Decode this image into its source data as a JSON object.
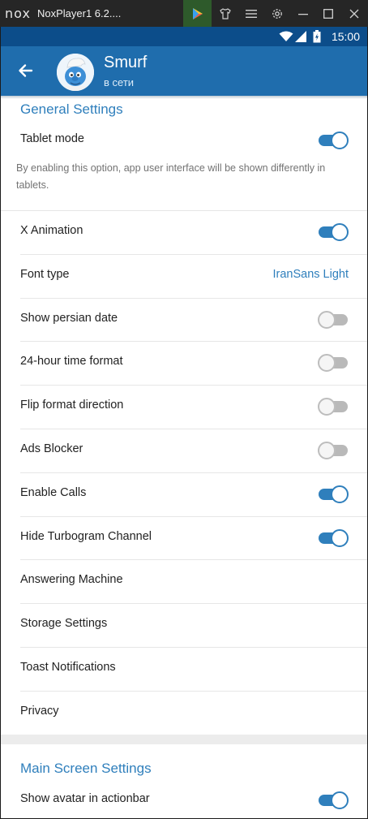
{
  "emulator": {
    "logo": "nox",
    "title": "NoxPlayer1 6.2....",
    "icons": [
      "play-store-icon",
      "shirt-icon",
      "menu-icon",
      "gear-icon",
      "minimize-icon",
      "maximize-icon",
      "close-icon"
    ]
  },
  "status_bar": {
    "time": "15:00",
    "icons": [
      "wifi-icon",
      "signal-icon",
      "battery-icon"
    ]
  },
  "action_bar": {
    "title": "Smurf",
    "subtitle": "в сети"
  },
  "general_settings": {
    "header": "General Settings",
    "tablet_mode": {
      "label": "Tablet mode",
      "on": true
    },
    "tablet_desc": "By enabling this option, app user interface will be shown differently in tablets.",
    "rows": [
      {
        "label": "X Animation",
        "type": "switch",
        "on": true
      },
      {
        "label": "Font type",
        "type": "value",
        "value": "IranSans Light"
      },
      {
        "label": "Show persian date",
        "type": "switch",
        "on": false
      },
      {
        "label": "24-hour time format",
        "type": "switch",
        "on": false
      },
      {
        "label": "Flip format direction",
        "type": "switch",
        "on": false
      },
      {
        "label": "Ads Blocker",
        "type": "switch",
        "on": false
      },
      {
        "label": "Enable Calls",
        "type": "switch",
        "on": true
      },
      {
        "label": "Hide Turbogram Channel",
        "type": "switch",
        "on": true
      },
      {
        "label": "Answering Machine",
        "type": "none"
      },
      {
        "label": "Storage Settings",
        "type": "none"
      },
      {
        "label": "Toast Notifications",
        "type": "none"
      },
      {
        "label": "Privacy",
        "type": "none"
      }
    ]
  },
  "main_screen_settings": {
    "header": "Main Screen Settings",
    "rows": [
      {
        "label": "Show avatar in actionbar",
        "type": "switch",
        "on": true
      }
    ]
  },
  "colors": {
    "accent": "#2f7fbc",
    "action_bar": "#1f6dad",
    "status_bar": "#0c4d8a"
  }
}
